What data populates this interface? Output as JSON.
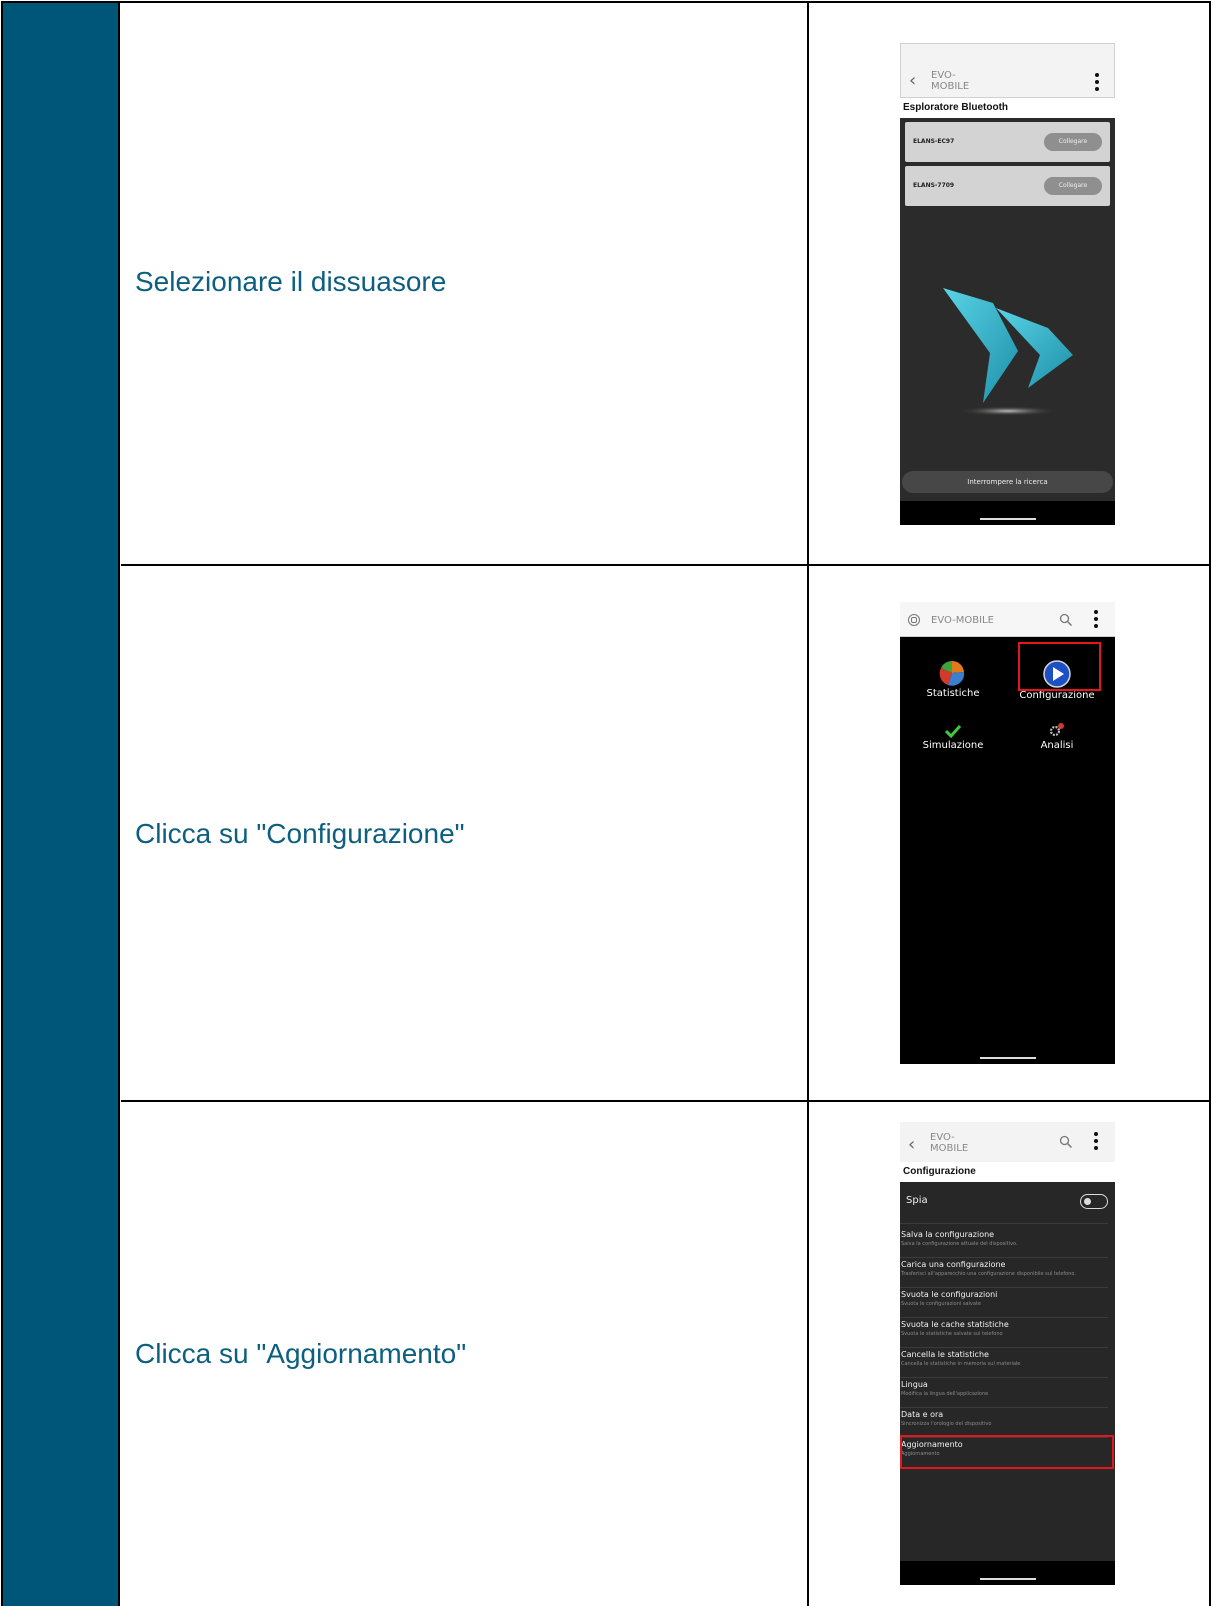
{
  "rows": [
    {
      "label": "Selezionare il dissuasore",
      "screen": {
        "app_name": "EVO-\nMOBILE",
        "subtitle": "Esploratore Bluetooth",
        "devices": [
          {
            "name": "ELANS-EC97",
            "button": "Collegare"
          },
          {
            "name": "ELANS-7709",
            "button": "Collegare"
          }
        ],
        "stop_button": "Interrompere la ricerca"
      }
    },
    {
      "label": "Clicca su \"Configurazione\"",
      "screen": {
        "app_name": "EVO-MOBILE",
        "tiles": [
          {
            "label": "Statistiche",
            "icon": "pie-chart-icon"
          },
          {
            "label": "Configurazione",
            "icon": "play-icon"
          },
          {
            "label": "Simulazione",
            "icon": "checkmark-icon"
          },
          {
            "label": "Analisi",
            "icon": "gears-icon"
          }
        ]
      }
    },
    {
      "label": "Clicca su \"Aggiornamento\"",
      "screen": {
        "app_name": "EVO-\nMOBILE",
        "subtitle": "Configurazione",
        "toggle_label": "Spia",
        "settings": [
          {
            "title": "Salva la configurazione",
            "desc": "Salva la configurazione attuale del dispositivo."
          },
          {
            "title": "Carica una configurazione",
            "desc": "Trasferisci all'apparecchio una configurazione disponibile sul telefono."
          },
          {
            "title": "Svuota le configurazioni",
            "desc": "Svuota le configurazioni salvate"
          },
          {
            "title": "Svuota le cache statistiche",
            "desc": "Svuota le statistiche salvate sul telefono"
          },
          {
            "title": "Cancella le statistiche",
            "desc": "Cancella le statistiche in memoria sul materiale"
          },
          {
            "title": "Lingua",
            "desc": "Modifica la lingua dell'applicazione"
          },
          {
            "title": "Data e ora",
            "desc": "Sincronizza l'orologio del dispositivo"
          },
          {
            "title": "Aggiornamento",
            "desc": "Aggiornamento"
          }
        ]
      }
    }
  ],
  "colors": {
    "sidebar": "#005679",
    "label_text": "#0d5f80",
    "highlight": "#e3161c"
  }
}
